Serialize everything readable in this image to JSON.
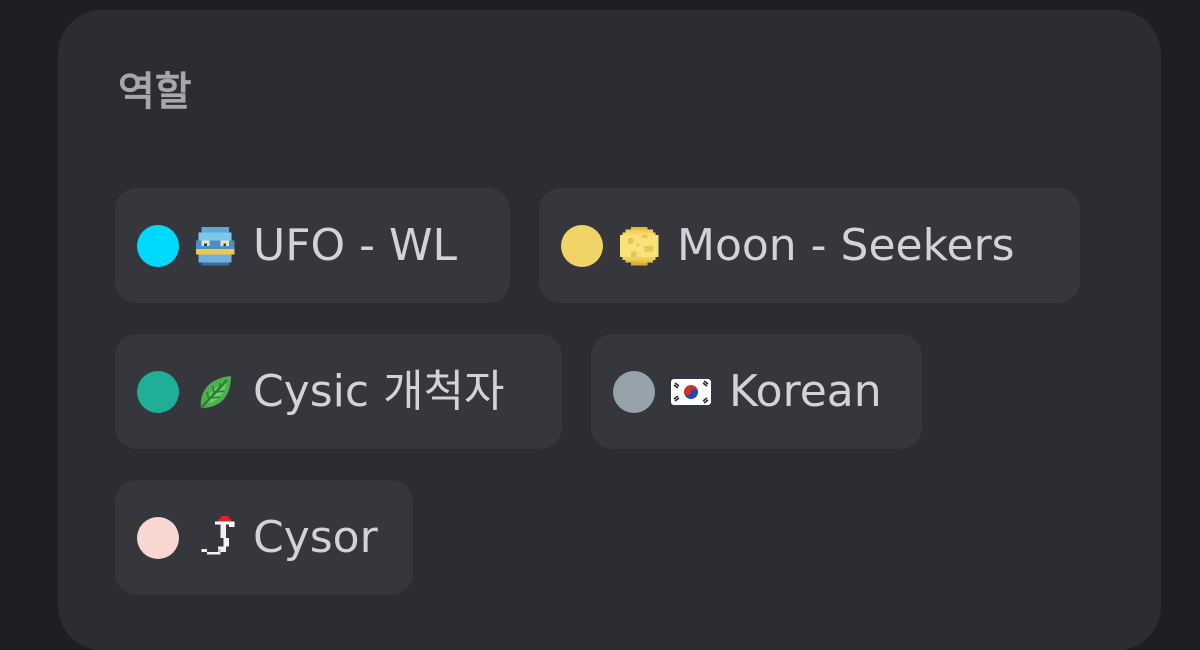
{
  "section": {
    "title": "역할"
  },
  "roles": [
    {
      "label": "UFO - WL",
      "color": "#00d9ff",
      "icon": "ufo-pixel-icon"
    },
    {
      "label": "Moon - Seekers",
      "color": "#f2d466",
      "icon": "moon-pixel-icon"
    },
    {
      "label": "Cysic 개척자",
      "color": "#1fae98",
      "icon": "leaf-icon"
    },
    {
      "label": "Korean",
      "color": "#96a3ab",
      "icon": "south-korea-flag-icon"
    },
    {
      "label": "Cysor",
      "color": "#f8d6d2",
      "icon": "santa-cysor-pixel-icon"
    }
  ]
}
